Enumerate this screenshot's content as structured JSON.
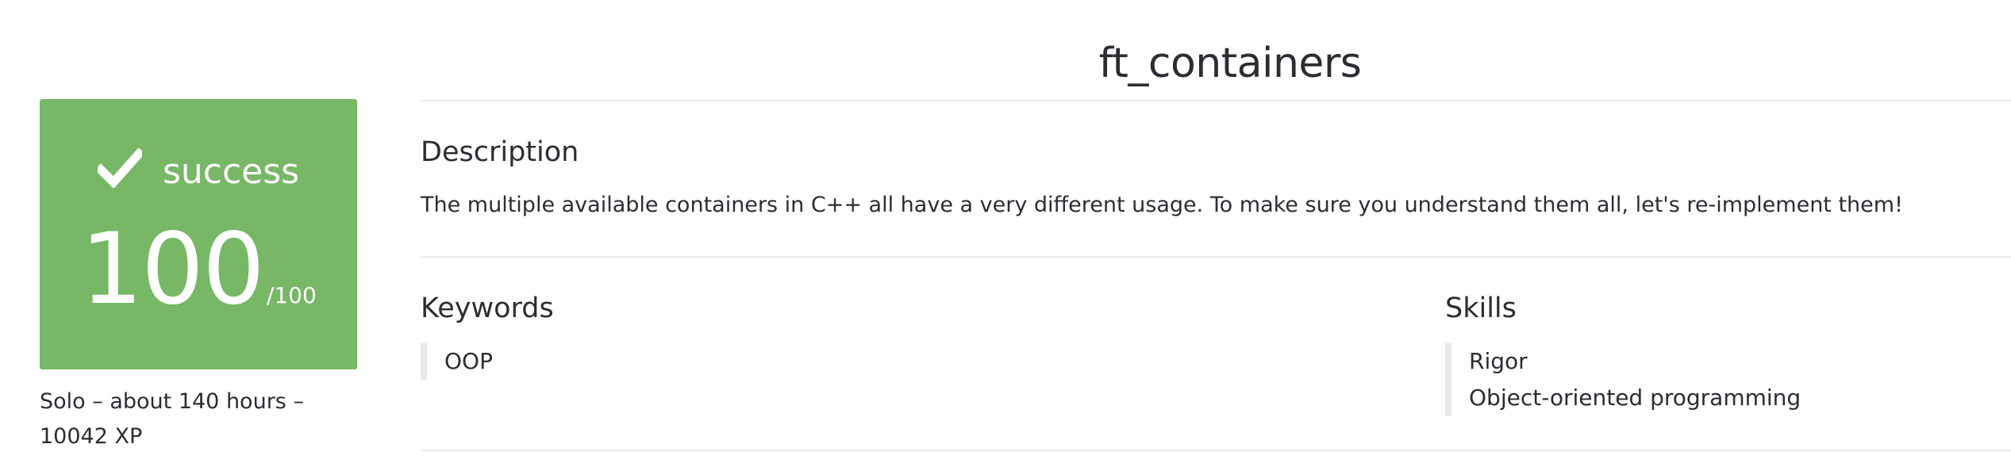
{
  "project": {
    "title": "ft_containers"
  },
  "result": {
    "status": "success",
    "score": "100",
    "score_max": "/100",
    "accent_color": "#77b766"
  },
  "meta": {
    "line1": "Solo – about 140 hours –",
    "line2": "10042 XP"
  },
  "description": {
    "heading": "Description",
    "text": "The multiple available containers in C++ all have a very different usage. To make sure you understand them all, let's re-implement them!"
  },
  "keywords": {
    "heading": "Keywords",
    "items": [
      "OOP"
    ]
  },
  "skills": {
    "heading": "Skills",
    "items": [
      "Rigor",
      "Object-oriented programming"
    ]
  }
}
